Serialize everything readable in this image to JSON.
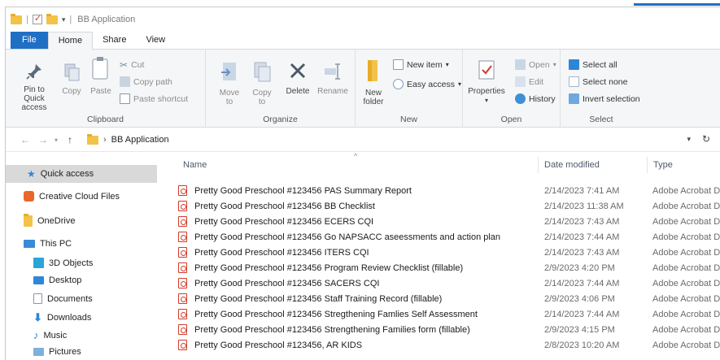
{
  "window": {
    "title": "BB Application"
  },
  "tabs": [
    {
      "label": "File"
    },
    {
      "label": "Home"
    },
    {
      "label": "Share"
    },
    {
      "label": "View"
    }
  ],
  "ribbon": {
    "clipboard": {
      "pin_label": "Pin to Quick access",
      "copy_label": "Copy",
      "paste_label": "Paste",
      "cut_label": "Cut",
      "copy_path_label": "Copy path",
      "paste_shortcut_label": "Paste shortcut",
      "group_label": "Clipboard"
    },
    "organize": {
      "move_label": "Move to",
      "copy_label": "Copy to",
      "delete_label": "Delete",
      "rename_label": "Rename",
      "group_label": "Organize"
    },
    "new": {
      "new_folder_label": "New folder",
      "new_item_label": "New item",
      "easy_access_label": "Easy access",
      "group_label": "New"
    },
    "open": {
      "properties_label": "Properties",
      "open_label": "Open",
      "edit_label": "Edit",
      "history_label": "History",
      "group_label": "Open"
    },
    "select": {
      "select_all_label": "Select all",
      "select_none_label": "Select none",
      "invert_label": "Invert selection",
      "group_label": "Select"
    }
  },
  "address": {
    "path_separator": "›",
    "path": "BB Application"
  },
  "sidebar": {
    "items": [
      {
        "label": "Quick access"
      },
      {
        "label": "Creative Cloud Files"
      },
      {
        "label": "OneDrive"
      },
      {
        "label": "This PC"
      },
      {
        "label": "3D Objects"
      },
      {
        "label": "Desktop"
      },
      {
        "label": "Documents"
      },
      {
        "label": "Downloads"
      },
      {
        "label": "Music"
      },
      {
        "label": "Pictures"
      }
    ]
  },
  "columns": {
    "name": "Name",
    "date": "Date modified",
    "type": "Type"
  },
  "files": [
    {
      "name": "Pretty Good Preschool #123456  PAS Summary Report",
      "date": "2/14/2023 7:41 AM",
      "type": "Adobe Acrobat D..."
    },
    {
      "name": "Pretty Good Preschool #123456 BB Checklist",
      "date": "2/14/2023 11:38 AM",
      "type": "Adobe Acrobat D..."
    },
    {
      "name": "Pretty Good Preschool #123456 ECERS CQI",
      "date": "2/14/2023 7:43 AM",
      "type": "Adobe Acrobat D..."
    },
    {
      "name": "Pretty Good Preschool #123456 Go NAPSACC aseessments and action plan",
      "date": "2/14/2023 7:44 AM",
      "type": "Adobe Acrobat D..."
    },
    {
      "name": "Pretty Good Preschool #123456 ITERS CQI",
      "date": "2/14/2023 7:43 AM",
      "type": "Adobe Acrobat D..."
    },
    {
      "name": "Pretty Good Preschool #123456 Program Review Checklist (fillable)",
      "date": "2/9/2023 4:20 PM",
      "type": "Adobe Acrobat D..."
    },
    {
      "name": "Pretty Good Preschool #123456 SACERS CQI",
      "date": "2/14/2023 7:44 AM",
      "type": "Adobe Acrobat D..."
    },
    {
      "name": "Pretty Good Preschool #123456 Staff Training Record  (fillable)",
      "date": "2/9/2023 4:06 PM",
      "type": "Adobe Acrobat D..."
    },
    {
      "name": "Pretty Good Preschool #123456 Stregthening Famlies Self Assessment",
      "date": "2/14/2023 7:44 AM",
      "type": "Adobe Acrobat D..."
    },
    {
      "name": "Pretty Good Preschool #123456 Strengthening Families form (fillable)",
      "date": "2/9/2023 4:15 PM",
      "type": "Adobe Acrobat D..."
    },
    {
      "name": "Pretty Good Preschool #123456, AR KIDS",
      "date": "2/8/2023 10:20 AM",
      "type": "Adobe Acrobat D..."
    }
  ],
  "colors": {
    "accent": "#1f6fc5",
    "folder": "#f2c348",
    "pdf_red": "#d23b2b",
    "selection": "#d9d9d9"
  }
}
